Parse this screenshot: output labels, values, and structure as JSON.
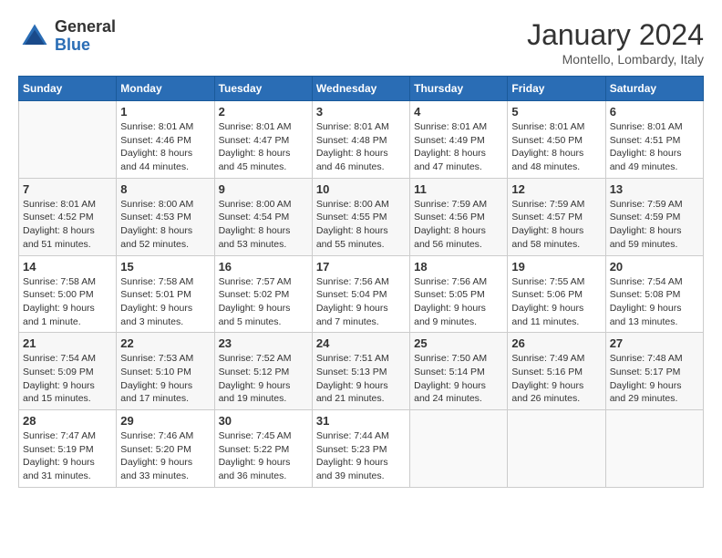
{
  "logo": {
    "line1": "General",
    "line2": "Blue"
  },
  "title": "January 2024",
  "location": "Montello, Lombardy, Italy",
  "days_of_week": [
    "Sunday",
    "Monday",
    "Tuesday",
    "Wednesday",
    "Thursday",
    "Friday",
    "Saturday"
  ],
  "weeks": [
    [
      {
        "day": "",
        "info": ""
      },
      {
        "day": "1",
        "info": "Sunrise: 8:01 AM\nSunset: 4:46 PM\nDaylight: 8 hours\nand 44 minutes."
      },
      {
        "day": "2",
        "info": "Sunrise: 8:01 AM\nSunset: 4:47 PM\nDaylight: 8 hours\nand 45 minutes."
      },
      {
        "day": "3",
        "info": "Sunrise: 8:01 AM\nSunset: 4:48 PM\nDaylight: 8 hours\nand 46 minutes."
      },
      {
        "day": "4",
        "info": "Sunrise: 8:01 AM\nSunset: 4:49 PM\nDaylight: 8 hours\nand 47 minutes."
      },
      {
        "day": "5",
        "info": "Sunrise: 8:01 AM\nSunset: 4:50 PM\nDaylight: 8 hours\nand 48 minutes."
      },
      {
        "day": "6",
        "info": "Sunrise: 8:01 AM\nSunset: 4:51 PM\nDaylight: 8 hours\nand 49 minutes."
      }
    ],
    [
      {
        "day": "7",
        "info": "Sunrise: 8:01 AM\nSunset: 4:52 PM\nDaylight: 8 hours\nand 51 minutes."
      },
      {
        "day": "8",
        "info": "Sunrise: 8:00 AM\nSunset: 4:53 PM\nDaylight: 8 hours\nand 52 minutes."
      },
      {
        "day": "9",
        "info": "Sunrise: 8:00 AM\nSunset: 4:54 PM\nDaylight: 8 hours\nand 53 minutes."
      },
      {
        "day": "10",
        "info": "Sunrise: 8:00 AM\nSunset: 4:55 PM\nDaylight: 8 hours\nand 55 minutes."
      },
      {
        "day": "11",
        "info": "Sunrise: 7:59 AM\nSunset: 4:56 PM\nDaylight: 8 hours\nand 56 minutes."
      },
      {
        "day": "12",
        "info": "Sunrise: 7:59 AM\nSunset: 4:57 PM\nDaylight: 8 hours\nand 58 minutes."
      },
      {
        "day": "13",
        "info": "Sunrise: 7:59 AM\nSunset: 4:59 PM\nDaylight: 8 hours\nand 59 minutes."
      }
    ],
    [
      {
        "day": "14",
        "info": "Sunrise: 7:58 AM\nSunset: 5:00 PM\nDaylight: 9 hours\nand 1 minute."
      },
      {
        "day": "15",
        "info": "Sunrise: 7:58 AM\nSunset: 5:01 PM\nDaylight: 9 hours\nand 3 minutes."
      },
      {
        "day": "16",
        "info": "Sunrise: 7:57 AM\nSunset: 5:02 PM\nDaylight: 9 hours\nand 5 minutes."
      },
      {
        "day": "17",
        "info": "Sunrise: 7:56 AM\nSunset: 5:04 PM\nDaylight: 9 hours\nand 7 minutes."
      },
      {
        "day": "18",
        "info": "Sunrise: 7:56 AM\nSunset: 5:05 PM\nDaylight: 9 hours\nand 9 minutes."
      },
      {
        "day": "19",
        "info": "Sunrise: 7:55 AM\nSunset: 5:06 PM\nDaylight: 9 hours\nand 11 minutes."
      },
      {
        "day": "20",
        "info": "Sunrise: 7:54 AM\nSunset: 5:08 PM\nDaylight: 9 hours\nand 13 minutes."
      }
    ],
    [
      {
        "day": "21",
        "info": "Sunrise: 7:54 AM\nSunset: 5:09 PM\nDaylight: 9 hours\nand 15 minutes."
      },
      {
        "day": "22",
        "info": "Sunrise: 7:53 AM\nSunset: 5:10 PM\nDaylight: 9 hours\nand 17 minutes."
      },
      {
        "day": "23",
        "info": "Sunrise: 7:52 AM\nSunset: 5:12 PM\nDaylight: 9 hours\nand 19 minutes."
      },
      {
        "day": "24",
        "info": "Sunrise: 7:51 AM\nSunset: 5:13 PM\nDaylight: 9 hours\nand 21 minutes."
      },
      {
        "day": "25",
        "info": "Sunrise: 7:50 AM\nSunset: 5:14 PM\nDaylight: 9 hours\nand 24 minutes."
      },
      {
        "day": "26",
        "info": "Sunrise: 7:49 AM\nSunset: 5:16 PM\nDaylight: 9 hours\nand 26 minutes."
      },
      {
        "day": "27",
        "info": "Sunrise: 7:48 AM\nSunset: 5:17 PM\nDaylight: 9 hours\nand 29 minutes."
      }
    ],
    [
      {
        "day": "28",
        "info": "Sunrise: 7:47 AM\nSunset: 5:19 PM\nDaylight: 9 hours\nand 31 minutes."
      },
      {
        "day": "29",
        "info": "Sunrise: 7:46 AM\nSunset: 5:20 PM\nDaylight: 9 hours\nand 33 minutes."
      },
      {
        "day": "30",
        "info": "Sunrise: 7:45 AM\nSunset: 5:22 PM\nDaylight: 9 hours\nand 36 minutes."
      },
      {
        "day": "31",
        "info": "Sunrise: 7:44 AM\nSunset: 5:23 PM\nDaylight: 9 hours\nand 39 minutes."
      },
      {
        "day": "",
        "info": ""
      },
      {
        "day": "",
        "info": ""
      },
      {
        "day": "",
        "info": ""
      }
    ]
  ]
}
